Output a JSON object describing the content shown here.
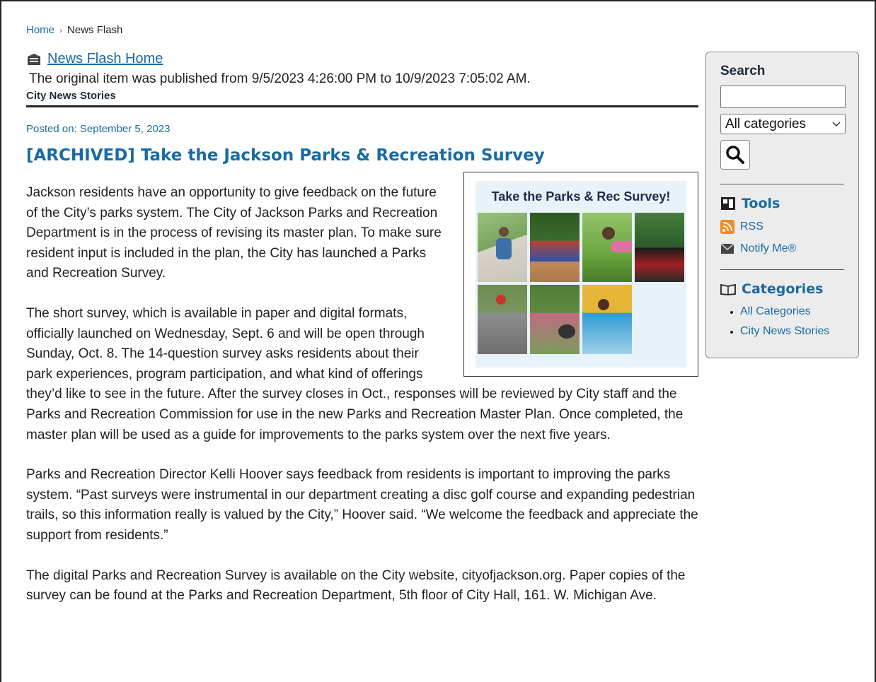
{
  "breadcrumb": {
    "home": "Home",
    "separator": "›",
    "current": "News Flash"
  },
  "news_flash_home": {
    "label": "News Flash Home",
    "icon": "newspaper-icon"
  },
  "published_note": "The original item was published from 9/5/2023 4:26:00 PM to 10/9/2023 7:05:02 AM.",
  "category": "City News Stories",
  "posted_on": "Posted on: September 5, 2023",
  "title": "[ARCHIVED] Take the Jackson Parks & Recreation Survey",
  "figure": {
    "title": "Take the Parks & Rec Survey!"
  },
  "paragraphs": [
    "Jackson residents have an opportunity to give feedback on the future of the City’s parks system. The City of Jackson Parks and Recreation Department is in the process of revising its master plan. To make sure resident input is included in the plan, the City has launched a Parks and Recreation Survey.",
    "The short survey, which is available in paper and digital formats, officially launched on Wednesday, Sept. 6 and will be open through Sunday, Oct. 8. The 14-question survey asks residents about their park experiences, program participation, and what kind of offerings they’d like to see in the future. After the survey closes in Oct., responses will be reviewed by City staff and the Parks and Recreation Commission for use in the new Parks and Recreation Master Plan. Once completed, the master plan will be used as a guide for improvements to the parks system over the next five years.",
    "Parks and Recreation Director Kelli Hoover says feedback from residents is important to improving the parks system. “Past surveys were instrumental in our department creating a disc golf course and expanding pedestrian trails, so this information really is valued by the City,” Hoover said. “We welcome the feedback and appreciate the support from residents.”",
    "The digital Parks and Recreation Survey is available on the City website, cityofjackson.org. Paper copies of the survey can be found at the Parks and Recreation Department, 5th floor of City Hall, 161. W. Michigan Ave."
  ],
  "sidebar": {
    "search_heading": "Search",
    "search_value": "",
    "category_select": "All categories",
    "tools_heading": "Tools",
    "tools": [
      {
        "label": "RSS",
        "icon": "rss-icon"
      },
      {
        "label": "Notify Me®",
        "icon": "envelope-icon"
      }
    ],
    "categories_heading": "Categories",
    "categories": [
      "All Categories",
      "City News Stories"
    ]
  },
  "colors": {
    "link": "#1a6aa3",
    "text": "#222222",
    "sidebar_bg": "#ececec",
    "figure_bg": "#e7f2fa"
  }
}
